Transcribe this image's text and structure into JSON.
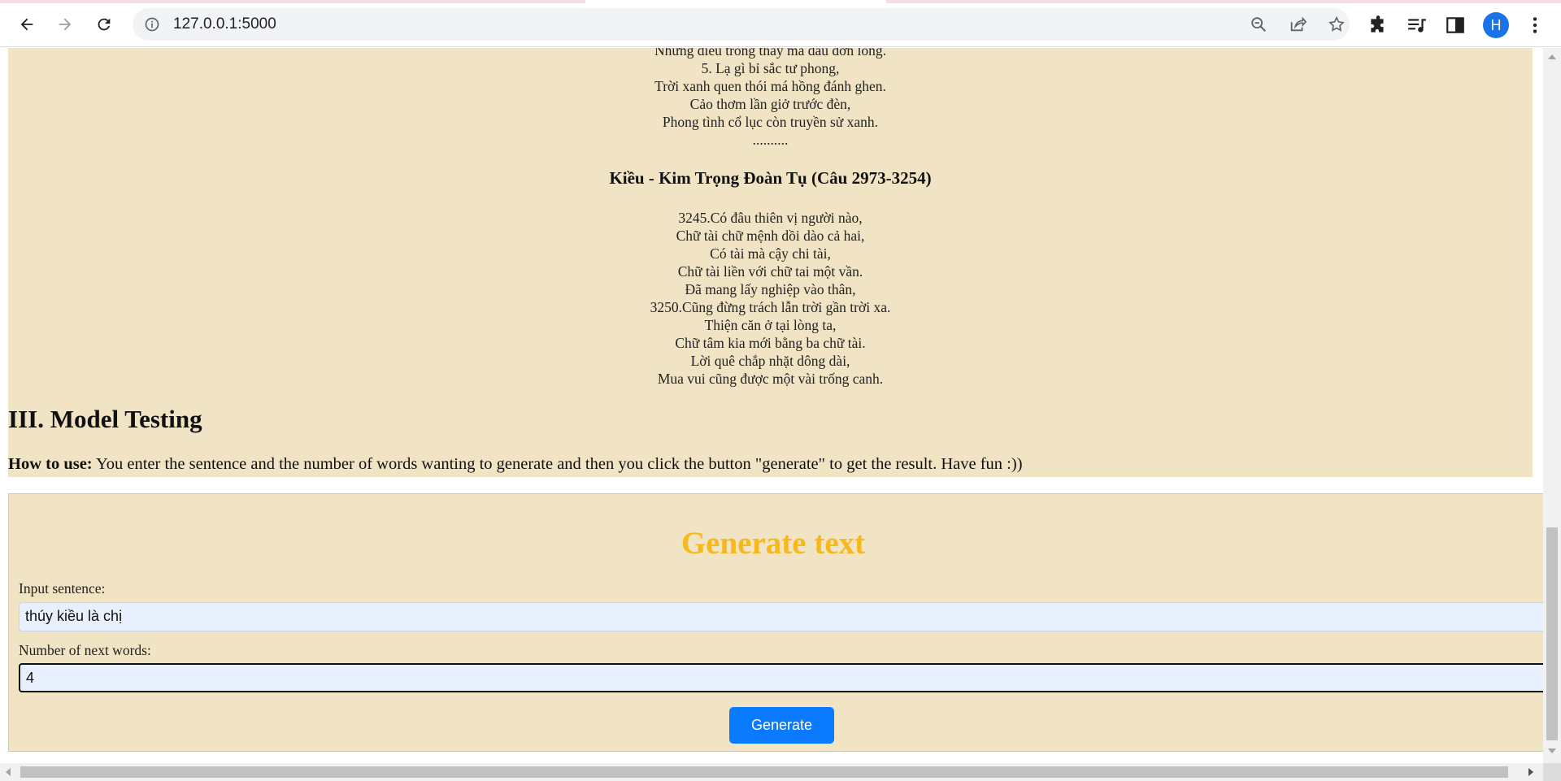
{
  "browser": {
    "url": "127.0.0.1:5000",
    "profile_initial": "H",
    "icons": [
      "back-icon",
      "forward-icon",
      "reload-icon",
      "info-icon",
      "zoom-out-icon",
      "share-icon",
      "star-icon",
      "extensions-icon",
      "media-icon",
      "sidepanel-icon",
      "menu-icon"
    ]
  },
  "poem": {
    "lines_top": [
      "Những điều trông thấy mà đau đớn lòng.",
      "5. Lạ gì bỉ sắc tư phong,",
      "Trời xanh quen thói má hồng đánh ghen.",
      "Cảo thơm lần giở trước đèn,",
      "Phong tình cổ lục còn truyền sử xanh.",
      ".........."
    ],
    "section_heading": "Kiều - Kim Trọng Đoàn Tụ (Câu 2973-3254)",
    "lines_bottom": [
      "3245.Có đâu thiên vị người nào,",
      "Chữ tài chữ mệnh dồi dào cả hai,",
      "Có tài mà cậy chi tài,",
      "Chữ tài liền với chữ tai một vần.",
      "Đã mang lấy nghiệp vào thân,",
      "3250.Cũng đừng trách lẫn trời gần trời xa.",
      "Thiện căn ở tại lòng ta,",
      "Chữ tâm kia mới bằng ba chữ tài.",
      "Lời quê chắp nhặt dông dài,",
      "Mua vui cũng được một vài trống canh."
    ]
  },
  "testing": {
    "title": "III. Model Testing",
    "howto_label": "How to use:",
    "howto_text": " You enter the sentence and the number of words wanting to generate and then you click the button \"generate\" to get the result. Have fun :))"
  },
  "generator": {
    "title": "Generate text",
    "title_color": "#f6b81c",
    "sentence_label": "Input sentence:",
    "sentence_value": "thúy kiều là chị",
    "words_label": "Number of next words:",
    "words_value": "4",
    "button_label": "Generate",
    "button_color": "#0a7bff"
  }
}
